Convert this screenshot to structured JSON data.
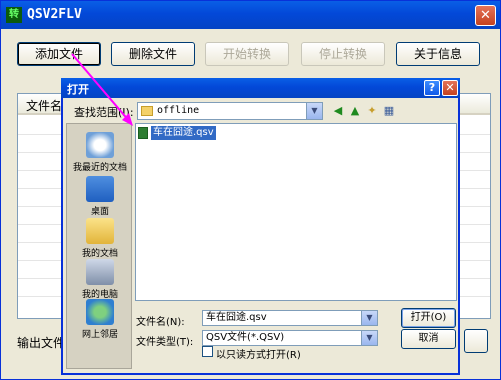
{
  "main": {
    "title": "QSV2FLV",
    "app_icon": "转",
    "buttons": {
      "add": "添加文件",
      "delete": "删除文件",
      "start": "开始转换",
      "stop": "停止转换",
      "about": "关于信息"
    },
    "list_header": "文件名",
    "output_label": "输出文件"
  },
  "dialog": {
    "title": "打开",
    "look_in_label": "查找范围(I):",
    "look_in_value": "offline",
    "places": [
      "我最近的文档",
      "桌面",
      "我的文档",
      "我的电脑",
      "网上邻居"
    ],
    "files": [
      "车在囧途.qsv"
    ],
    "filename_label": "文件名(N):",
    "filename_value": "车在囧途.qsv",
    "filetype_label": "文件类型(T):",
    "filetype_value": "QSV文件(*.QSV)",
    "readonly_label": "以只读方式打开(R)",
    "open_button": "打开(O)",
    "cancel_button": "取消"
  },
  "colors": {
    "titlebar": "#0348d8",
    "selection": "#316ac5",
    "arrow": "#ff00ff"
  }
}
